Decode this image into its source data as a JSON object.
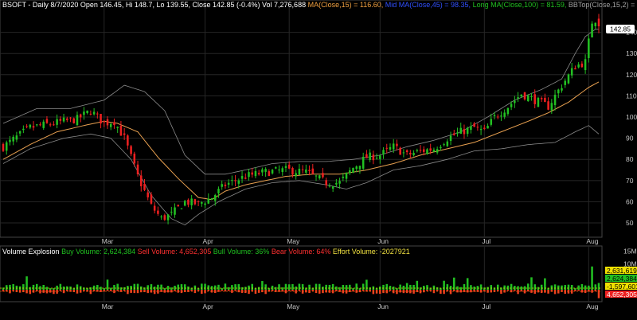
{
  "price_header": {
    "symbol_line": "BSOFT - Daily 8/7/2020 Open 146.45, Hi 148.7, Lo 139.55, Close 142.85 (-0.4%) Vol 7,276,688",
    "ma15": "MA(Close,15) = 116.60,",
    "mid_ma": "Mid MA(Close,45) = 98.35,",
    "long_ma": "Long MA(Close,100) = 81.59,",
    "bbtop": "BBTop(Close,15,2) = 141.43,"
  },
  "volume_header": {
    "title": "Volume Explosion",
    "buy": "Buy Volume: 2,624,384",
    "sell": "Sell Volume: 4,652,305",
    "bull": "Bull Volume: 36%",
    "bear": "Bear Volume: 64%",
    "effort": "Effort Volume: -2027921"
  },
  "chart_data": [
    {
      "type": "candlestick",
      "title": "BSOFT - Daily 8/7/2020",
      "y_ticks": [
        50,
        60,
        70,
        80,
        90,
        100,
        110,
        120,
        130,
        140
      ],
      "ylim": [
        44,
        150
      ],
      "x_ticks": [
        "Mar",
        "Apr",
        "May",
        "Jun",
        "Jul",
        "Aug"
      ],
      "x_tick_index": [
        30,
        60,
        85,
        112,
        143,
        174
      ],
      "last_price_label": "142.85",
      "n_bars": 178,
      "anchors_close": [
        [
          0,
          86
        ],
        [
          8,
          95
        ],
        [
          18,
          98
        ],
        [
          22,
          99
        ],
        [
          26,
          103
        ],
        [
          30,
          97
        ],
        [
          33,
          98
        ],
        [
          36,
          90
        ],
        [
          40,
          72
        ],
        [
          44,
          58
        ],
        [
          47,
          52
        ],
        [
          50,
          54
        ],
        [
          54,
          60
        ],
        [
          58,
          59
        ],
        [
          62,
          62
        ],
        [
          66,
          68
        ],
        [
          72,
          72
        ],
        [
          78,
          74
        ],
        [
          84,
          75
        ],
        [
          90,
          74
        ],
        [
          96,
          69
        ],
        [
          100,
          69
        ],
        [
          104,
          76
        ],
        [
          108,
          81
        ],
        [
          112,
          82
        ],
        [
          116,
          86
        ],
        [
          120,
          82
        ],
        [
          124,
          84
        ],
        [
          128,
          85
        ],
        [
          132,
          90
        ],
        [
          136,
          93
        ],
        [
          140,
          95
        ],
        [
          143,
          93
        ],
        [
          146,
          100
        ],
        [
          150,
          105
        ],
        [
          154,
          111
        ],
        [
          158,
          108
        ],
        [
          162,
          105
        ],
        [
          166,
          115
        ],
        [
          170,
          124
        ],
        [
          173,
          126
        ],
        [
          175,
          145
        ],
        [
          176,
          146
        ],
        [
          177,
          142.85
        ]
      ],
      "bb_upper_anchors": [
        [
          0,
          97
        ],
        [
          10,
          104
        ],
        [
          20,
          104
        ],
        [
          30,
          108
        ],
        [
          36,
          115
        ],
        [
          42,
          112
        ],
        [
          48,
          103
        ],
        [
          54,
          82
        ],
        [
          60,
          73
        ],
        [
          66,
          73
        ],
        [
          72,
          75
        ],
        [
          80,
          78
        ],
        [
          88,
          79
        ],
        [
          96,
          79
        ],
        [
          104,
          80
        ],
        [
          112,
          82
        ],
        [
          120,
          86
        ],
        [
          128,
          89
        ],
        [
          136,
          93
        ],
        [
          144,
          100
        ],
        [
          152,
          108
        ],
        [
          160,
          113
        ],
        [
          166,
          118
        ],
        [
          170,
          130
        ],
        [
          173,
          138
        ],
        [
          176,
          141.43
        ]
      ],
      "bb_lower_anchors": [
        [
          0,
          78
        ],
        [
          8,
          85
        ],
        [
          18,
          90
        ],
        [
          26,
          92
        ],
        [
          32,
          90
        ],
        [
          38,
          80
        ],
        [
          44,
          63
        ],
        [
          50,
          52
        ],
        [
          54,
          49
        ],
        [
          58,
          54
        ],
        [
          64,
          60
        ],
        [
          72,
          66
        ],
        [
          80,
          69
        ],
        [
          88,
          70
        ],
        [
          96,
          68
        ],
        [
          102,
          66
        ],
        [
          108,
          69
        ],
        [
          116,
          75
        ],
        [
          124,
          77
        ],
        [
          132,
          80
        ],
        [
          140,
          84
        ],
        [
          148,
          85
        ],
        [
          156,
          87
        ],
        [
          164,
          88
        ],
        [
          170,
          93
        ],
        [
          174,
          96
        ],
        [
          177,
          92
        ]
      ],
      "ma_anchors": [
        [
          0,
          80
        ],
        [
          8,
          87
        ],
        [
          16,
          93
        ],
        [
          24,
          96
        ],
        [
          30,
          98
        ],
        [
          34,
          97
        ],
        [
          40,
          93
        ],
        [
          46,
          81
        ],
        [
          52,
          71
        ],
        [
          58,
          62
        ],
        [
          62,
          61
        ],
        [
          66,
          65
        ],
        [
          72,
          68
        ],
        [
          78,
          70
        ],
        [
          84,
          72
        ],
        [
          92,
          73
        ],
        [
          100,
          73
        ],
        [
          108,
          75
        ],
        [
          116,
          78
        ],
        [
          124,
          82
        ],
        [
          132,
          85
        ],
        [
          140,
          88
        ],
        [
          148,
          93
        ],
        [
          156,
          98
        ],
        [
          162,
          102
        ],
        [
          168,
          107
        ],
        [
          174,
          114
        ],
        [
          177,
          116.6
        ]
      ]
    },
    {
      "type": "bar",
      "title": "Volume Explosion",
      "y_tick_labels": [
        "15M",
        "10M",
        "5M"
      ],
      "y_ticks": [
        15000000,
        10000000,
        5000000
      ],
      "right_labels": [
        "2,631,619",
        "2,624,384",
        "-1,597,601",
        "4,652,305"
      ],
      "last_buy_volume": 2624384,
      "last_sell_volume": 4652305,
      "spike_up_index": 175,
      "spike_up_value": 16000000
    }
  ]
}
